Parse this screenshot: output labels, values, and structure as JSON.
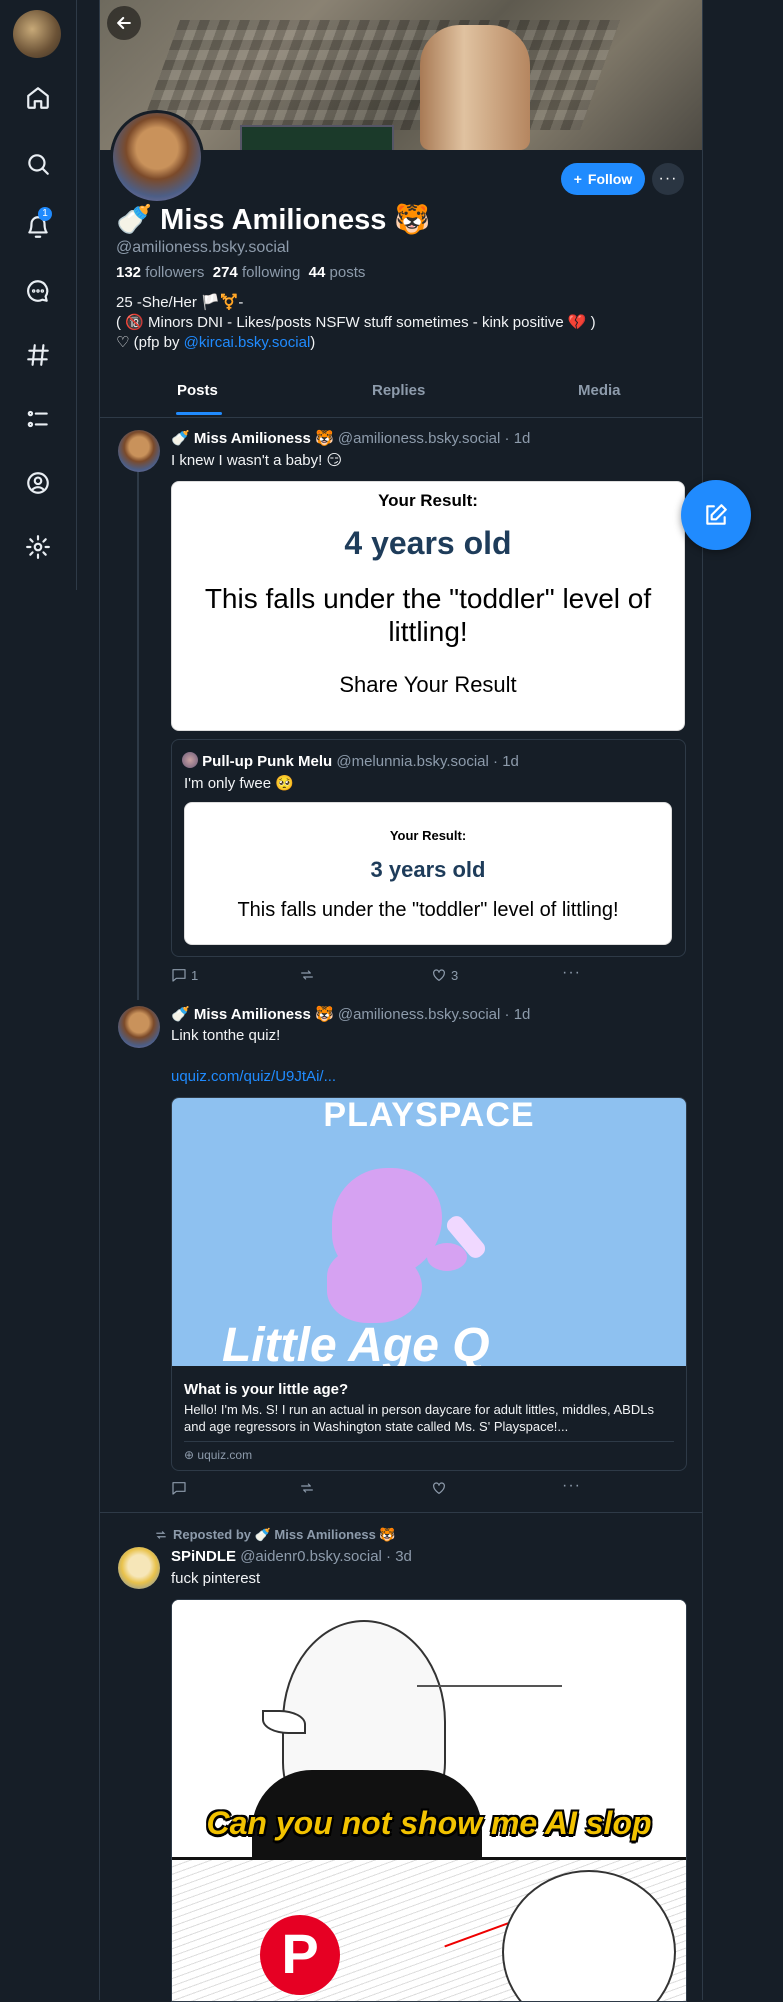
{
  "nav": {
    "notifications_count": "1",
    "items": [
      "home-icon",
      "search-icon",
      "bell-icon",
      "chat-icon",
      "hashtag-icon",
      "list-icon",
      "profile-icon",
      "gear-icon"
    ]
  },
  "profile": {
    "display_name": "🍼 Miss Amilioness 🐯",
    "handle": "@amilioness.bsky.social",
    "followers_count": "132",
    "followers_label": "followers",
    "following_count": "274",
    "following_label": "following",
    "posts_count": "44",
    "posts_label": "posts",
    "bio_line1": "25 -She/Her 🏳️⚧️-",
    "bio_line2": "( 🔞 Minors DNI - Likes/posts NSFW stuff sometimes - kink positive 💔 )",
    "bio_line3_prefix": "♡ (pfp by ",
    "bio_link": "@kircai.bsky.social",
    "bio_line3_suffix": ")",
    "follow_label": "Follow",
    "more_label": "···"
  },
  "tabs": [
    {
      "label": "Posts"
    },
    {
      "label": "Replies"
    },
    {
      "label": "Media"
    }
  ],
  "posts": [
    {
      "author": "🍼 Miss Amilioness 🐯",
      "handle": "@amilioness.bsky.social",
      "time": "· 1d",
      "text": "I knew I wasn't a baby! 😏",
      "quiz": {
        "label": "Your Result:",
        "age": "4 years old",
        "desc": "This falls under the \"toddler\" level of littling!",
        "share": "Share Your Result"
      },
      "quote": {
        "author": "Pull-up Punk Melu",
        "handle": "@melunnia.bsky.social",
        "time": "· 1d",
        "text": "I'm only fwee 🥺",
        "quiz": {
          "label": "Your Result:",
          "age": "3 years old",
          "desc": "This falls under the \"toddler\" level of littling!"
        }
      },
      "reply_count": "1",
      "repost_count": "",
      "like_count": "3"
    },
    {
      "author": "🍼 Miss Amilioness 🐯",
      "handle": "@amilioness.bsky.social",
      "time": "· 1d",
      "text": "Link tonthe quiz!",
      "link": "uquiz.com/quiz/U9JtAi/...",
      "card": {
        "image_text_top": "PLAYSPACE",
        "image_text_bottom": "Little Age Q",
        "title": "What is your little age?",
        "description": "Hello! I'm Ms. S! I run an actual in person daycare for adult littles, middles, ABDLs and age regressors in Washington state called Ms. S' Playspace!...",
        "domain": "uquiz.com"
      },
      "reply_count": "",
      "repost_count": "",
      "like_count": ""
    },
    {
      "repost_label": "Reposted by 🍼 Miss Amilioness 🐯",
      "author": "SPiNDLE",
      "handle": "@aidenr0.bsky.social",
      "time": "· 3d",
      "text": "fuck pinterest",
      "comic_caption": "Can you not show me AI slop",
      "pin_letter": "P"
    }
  ],
  "colors": {
    "background": "#161e27",
    "accent": "#208bfe",
    "muted": "#8d9bab",
    "border": "#2e3a47"
  }
}
